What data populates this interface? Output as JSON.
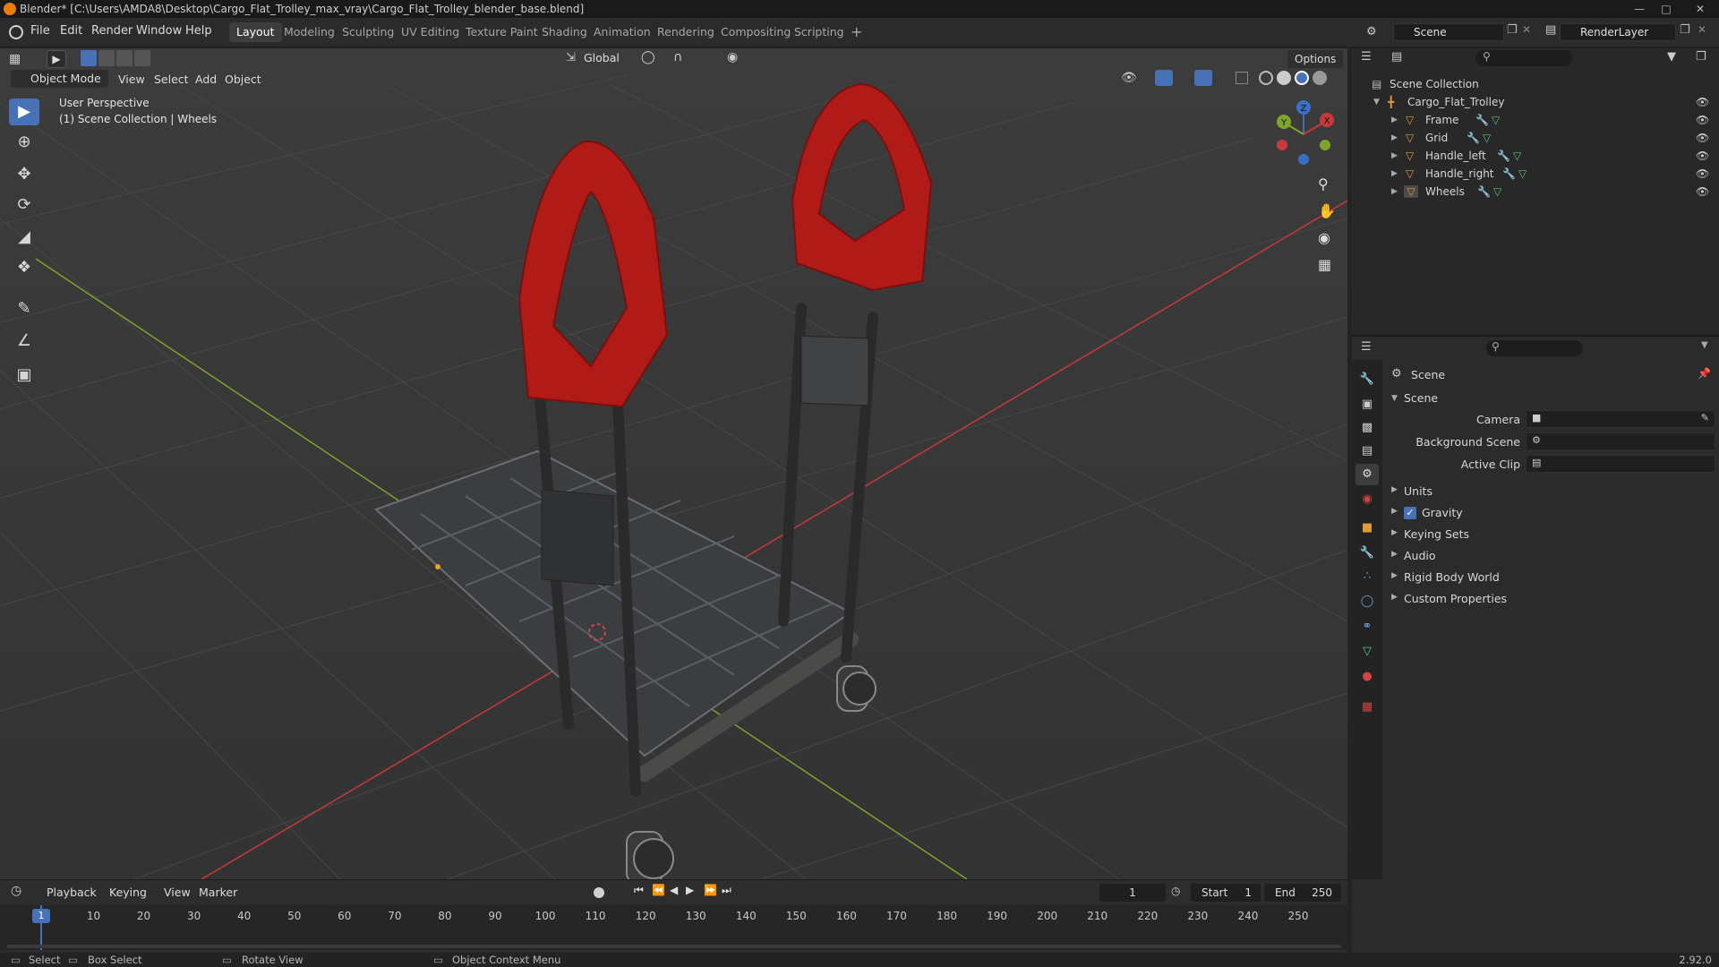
{
  "window": {
    "title": "Blender* [C:\\Users\\AMDA8\\Desktop\\Cargo_Flat_Trolley_max_vray\\Cargo_Flat_Trolley_blender_base.blend]"
  },
  "menu": [
    "File",
    "Edit",
    "Render",
    "Window",
    "Help"
  ],
  "workspaces": [
    "Layout",
    "Modeling",
    "Sculpting",
    "UV Editing",
    "Texture Paint",
    "Shading",
    "Animation",
    "Rendering",
    "Compositing",
    "Scripting"
  ],
  "workspace_add": "+",
  "scene_selector": "Scene",
  "render_layer": "RenderLayer",
  "viewport": {
    "transform_orientation": "Global",
    "options_label": "Options",
    "mode": "Object Mode",
    "header_menus": [
      "View",
      "Select",
      "Add",
      "Object"
    ],
    "overlay_line1": "User Perspective",
    "overlay_line2": "(1) Scene Collection | Wheels",
    "gizmo_axes": [
      "X",
      "Y",
      "Z"
    ]
  },
  "outliner": {
    "root": "Scene Collection",
    "collection": "Cargo_Flat_Trolley",
    "objects": [
      "Frame",
      "Grid",
      "Handle_left",
      "Handle_right",
      "Wheels"
    ]
  },
  "properties": {
    "context": "Scene",
    "panel": "Scene",
    "fields": [
      {
        "label": "Camera",
        "value": ""
      },
      {
        "label": "Background Scene",
        "value": ""
      },
      {
        "label": "Active Clip",
        "value": ""
      }
    ],
    "subpanels": [
      "Units",
      "Gravity",
      "Keying Sets",
      "Audio",
      "Rigid Body World",
      "Custom Properties"
    ],
    "gravity_checked": true
  },
  "timeline": {
    "menus": [
      "Playback",
      "Keying",
      "View",
      "Marker"
    ],
    "current_frame": "1",
    "start_label": "Start",
    "start": "1",
    "end_label": "End",
    "end": "250",
    "ticks": [
      "1",
      "10",
      "20",
      "30",
      "40",
      "50",
      "60",
      "70",
      "80",
      "90",
      "100",
      "110",
      "120",
      "130",
      "140",
      "150",
      "160",
      "170",
      "180",
      "190",
      "200",
      "210",
      "220",
      "230",
      "240",
      "250"
    ]
  },
  "statusbar": {
    "select": "Select",
    "box_select": "Box Select",
    "rotate_view": "Rotate View",
    "context_menu": "Object Context Menu",
    "version": "2.92.0"
  },
  "colors": {
    "accent": "#4872b8",
    "axis_x": "#c8393c",
    "axis_y": "#7ea52b",
    "handle_red": "#b01a17",
    "frame_dark": "#2a2a2a"
  }
}
